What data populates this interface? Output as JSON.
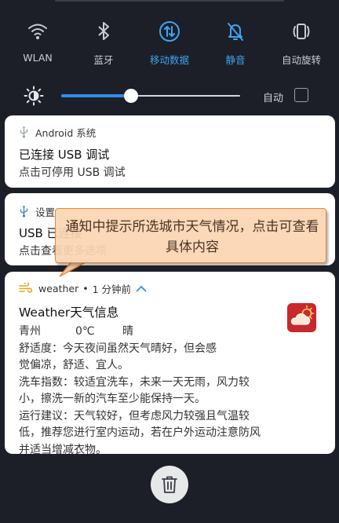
{
  "quick_settings": [
    {
      "label": "WLAN",
      "icon": "wifi-icon",
      "active": false
    },
    {
      "label": "蓝牙",
      "icon": "bluetooth-icon",
      "active": false
    },
    {
      "label": "移动数据",
      "icon": "mobile-data-icon",
      "active": true
    },
    {
      "label": "静音",
      "icon": "mute-icon",
      "active": true
    },
    {
      "label": "自动旋转",
      "icon": "auto-rotate-icon",
      "active": false
    }
  ],
  "brightness": {
    "level": 0.39,
    "auto_label": "自动",
    "auto_checked": false
  },
  "notifications": [
    {
      "app": "Android 系统",
      "title": "已连接 USB 调试",
      "text": "点击可停用 USB 调试"
    },
    {
      "app": "设置",
      "title": "USB 已连接",
      "text": "点击查看更多选项"
    }
  ],
  "weather": {
    "app": "weather",
    "time": "1 分钟前",
    "title": "Weather天气信息",
    "city": "青州",
    "temp": "0℃",
    "condition": "晴",
    "lines": [
      "舒适度：今天夜间虽然天气晴好，但会感",
      "觉偏凉，舒适、宜人。",
      "洗车指数：较适宜洗车，未来一天无雨，风力较",
      "小，擦洗一新的汽车至少能保持一天。",
      "运行建议：天气较好，但考虑风力较强且气温较",
      "低，推荐您进行室内运动，若在户外运动注意防风",
      "并适当增减衣物。"
    ]
  },
  "callout": {
    "text": "通知中提示所选城市天气情况，点击可查看具体内容"
  },
  "colors": {
    "accent": "#3ea4f2",
    "background": "#1c1f27",
    "callout_border": "#e8883a"
  }
}
